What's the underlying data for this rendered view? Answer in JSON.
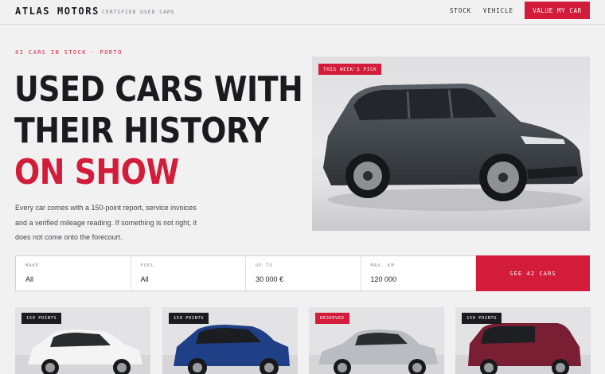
{
  "header": {
    "logo": "ATLAS MOTORS",
    "tagline": "CERTIFIED USED CARS",
    "nav": [
      {
        "label": "STOCK"
      },
      {
        "label": "VEHICLE"
      }
    ],
    "cta": "VALUE MY CAR"
  },
  "hero": {
    "eyebrow": "42 CARS IN STOCK · PORTO",
    "headline_lines": [
      "USED CARS WITH",
      "THEIR HISTORY"
    ],
    "headline_accent": "ON SHOW",
    "lede": "Every car comes with a 150-point report, service invoices and a verified mileage reading. If something is not right, it does not come onto the forecourt.",
    "badge": "THIS WEEK'S PICK",
    "photo_icon": "dark-grey-estate-car-photo"
  },
  "search": {
    "fields": [
      {
        "label": "MAKE",
        "value": "All"
      },
      {
        "label": "FUEL",
        "value": "All"
      },
      {
        "label": "UP TO",
        "value": "30 000 €"
      },
      {
        "label": "MAX. KM",
        "value": "120 000"
      }
    ],
    "button": "SEE 42 CARS"
  },
  "cards": [
    {
      "badge": "150 POINTS",
      "car_color": "#f4f4f5",
      "photo_icon": "white-hatchback-photo"
    },
    {
      "badge": "150 POINTS",
      "car_color": "#1f3f86",
      "photo_icon": "blue-suv-photo"
    },
    {
      "badge": "RESERVED",
      "car_color": "#b9bcc0",
      "photo_icon": "silver-sedan-photo"
    },
    {
      "badge": "150 POINTS",
      "car_color": "#7a1e33",
      "photo_icon": "maroon-van-photo"
    }
  ],
  "colors": {
    "accent": "#d31c3a",
    "background": "#f1f1f2",
    "text": "#1b1b1d",
    "badge_dark": "#1c1c1e"
  }
}
